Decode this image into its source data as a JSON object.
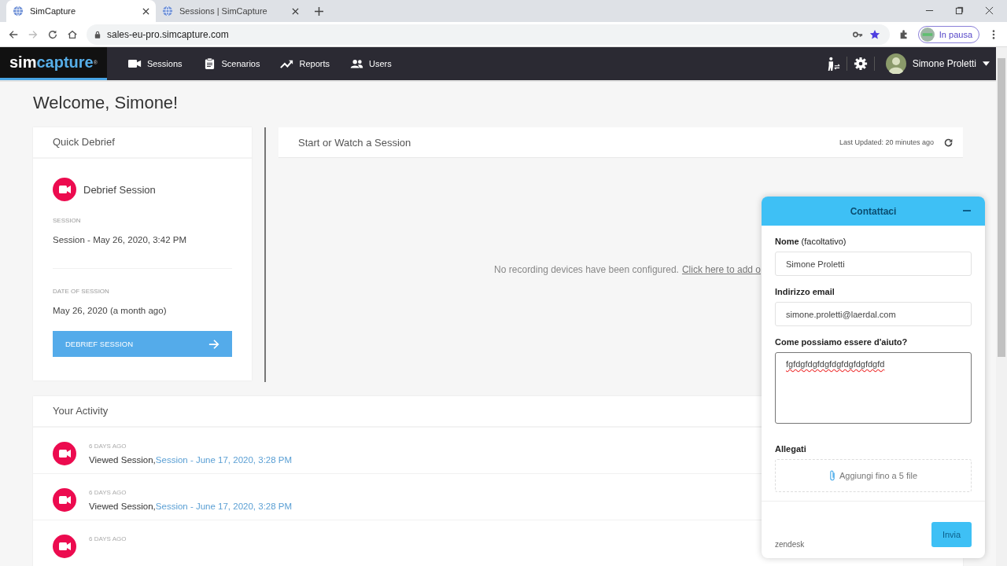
{
  "browser": {
    "tabs": [
      {
        "title": "SimCapture",
        "selected": true
      },
      {
        "title": "Sessions | SimCapture",
        "selected": false
      }
    ],
    "url": "sales-eu-pro.simcapture.com",
    "profile": "In pausa"
  },
  "app": {
    "logo": {
      "first": "sim",
      "second": "capture",
      "mark": "®"
    },
    "nav": [
      {
        "label": "Sessions"
      },
      {
        "label": "Scenarios"
      },
      {
        "label": "Reports"
      },
      {
        "label": "Users"
      }
    ],
    "user": "Simone Proletti"
  },
  "welcome": "Welcome, Simone!",
  "quick_debrief": {
    "title": "Quick Debrief",
    "item": "Debrief Session",
    "session_label": "SESSION",
    "session": "Session - May 26, 2020, 3:42 PM",
    "date_label": "DATE OF SESSION",
    "date": "May 26, 2020 (a month ago)",
    "button": "DEBRIEF SESSION"
  },
  "session_panel": {
    "title": "Start or Watch a Session",
    "last_updated": "Last Updated: 20 minutes ago",
    "message": "No recording devices have been configured.",
    "link": "Click here to add o"
  },
  "activity": {
    "title": "Your Activity",
    "items": [
      {
        "time": "6 DAYS AGO",
        "action": "Viewed Session,",
        "link": "Session - June 17, 2020, 3:28 PM"
      },
      {
        "time": "6 DAYS AGO",
        "action": "Viewed Session,",
        "link": "Session - June 17, 2020, 3:28 PM"
      },
      {
        "time": "6 DAYS AGO"
      }
    ]
  },
  "contact": {
    "title": "Contattaci",
    "fields": [
      {
        "kind": "input",
        "label": "**Nome** (facoltativo)",
        "value": "Simone Proletti"
      },
      {
        "kind": "input",
        "label": "Indirizzo email",
        "value": "simone.proletti@laerdal.com"
      },
      {
        "kind": "textarea",
        "label": "Come possiamo essere d'aiuto?",
        "value": "fgfdgfdgfdgfdgfdgfdgfdgfd"
      },
      {
        "kind": "attach",
        "label": "Allegati",
        "value": "Aggiungi fino a 5 file"
      }
    ],
    "brand": "zendesk",
    "submit": "Invia"
  }
}
